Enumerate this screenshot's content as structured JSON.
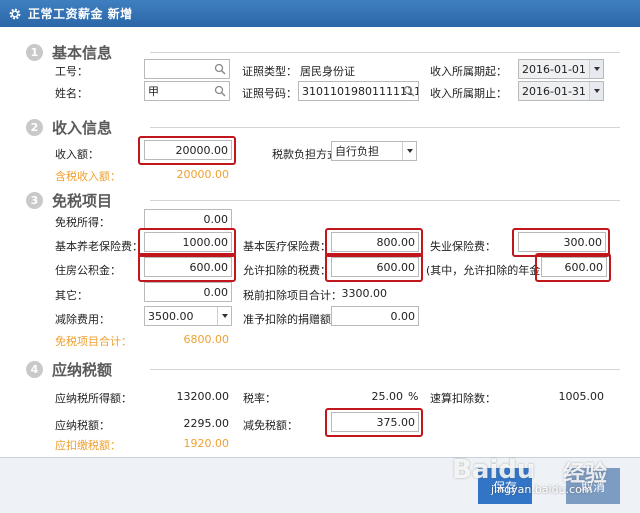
{
  "window": {
    "title": "正常工资薪金 新增"
  },
  "sections": {
    "basic": {
      "num": "1",
      "name": "基本信息"
    },
    "income": {
      "num": "2",
      "name": "收入信息"
    },
    "exempt": {
      "num": "3",
      "name": "免税项目"
    },
    "tax": {
      "num": "4",
      "name": "应纳税额"
    }
  },
  "basic": {
    "id_label": "工号：",
    "id_value": "",
    "name_label": "姓名：",
    "name_value": "甲",
    "cert_type_label": "证照类型：",
    "cert_type_value": "居民身份证",
    "cert_no_label": "证照号码：",
    "cert_no_value": "31011019801111111",
    "period_start_label": "收入所属期起：",
    "period_start_value": "2016-01-01",
    "period_end_label": "收入所属期止：",
    "period_end_value": "2016-01-31"
  },
  "income": {
    "amount_label": "收入额：",
    "amount_value": "20000.00",
    "bearing_label": "税款负担方式：",
    "bearing_value": "自行负担",
    "taxable_label": "含税收入额：",
    "taxable_value": "20000.00"
  },
  "exempt": {
    "free_income_label": "免税所得：",
    "free_income_value": "0.00",
    "pension_label": "基本养老保险费：",
    "pension_value": "1000.00",
    "medical_label": "基本医疗保险费：",
    "medical_value": "800.00",
    "unemployment_label": "失业保险费：",
    "unemployment_value": "300.00",
    "housing_label": "住房公积金：",
    "housing_value": "600.00",
    "allowed_tax_label": "允许扣除的税费：",
    "allowed_tax_value": "600.00",
    "annuity_label": "(其中，允许扣除的年金：",
    "annuity_value": "600.00",
    "other_label": "其它：",
    "other_value": "0.00",
    "pretax_total_label": "税前扣除项目合计：",
    "pretax_total_value": "3300.00",
    "deduction_label": "减除费用：",
    "deduction_value": "3500.00",
    "donation_label": "准予扣除的捐赠额：",
    "donation_value": "0.00",
    "exempt_total_label": "免税项目合计：",
    "exempt_total_value": "6800.00"
  },
  "tax": {
    "taxable_income_label": "应纳税所得额：",
    "taxable_income_value": "13200.00",
    "rate_label": "税率：",
    "rate_value": "25.00",
    "rate_unit": "%",
    "quick_deduction_label": "速算扣除数：",
    "quick_deduction_value": "1005.00",
    "tax_payable_label": "应纳税额：",
    "tax_payable_value": "2295.00",
    "relief_label": "减免税额：",
    "relief_value": "375.00",
    "withhold_label": "应扣缴税额：",
    "withhold_value": "1920.00"
  },
  "footer": {
    "save_label": "保存",
    "cancel_label": "取消"
  },
  "watermark": {
    "logo": "Baidu",
    "cn": "经验",
    "url": "jingyan.baidu.com"
  },
  "colors": {
    "title_bar": "#2a66a8",
    "highlight": "#c0161c",
    "orange_text": "#f0a030",
    "section_num": "#c9c9c9"
  },
  "icons": {
    "title": "gear-icon",
    "lookup": "search-icon",
    "dropdown": "chevron-down-icon"
  }
}
